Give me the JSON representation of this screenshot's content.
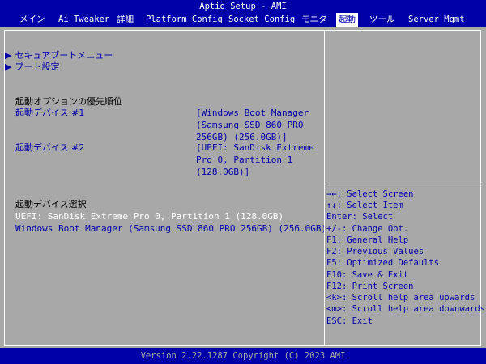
{
  "window": {
    "title": "Aptio Setup - AMI"
  },
  "tabs": [
    {
      "label": "メイン"
    },
    {
      "label": "Ai Tweaker"
    },
    {
      "label": "詳細"
    },
    {
      "label": "Platform Config"
    },
    {
      "label": "Socket Config"
    },
    {
      "label": "モニタ"
    },
    {
      "label": "起動",
      "active": true
    },
    {
      "label": "ツール"
    },
    {
      "label": "Server Mgmt"
    }
  ],
  "main": {
    "submenus": [
      {
        "arrow": "▶",
        "label": "セキュアブートメニュー"
      },
      {
        "arrow": "▶",
        "label": "ブート設定"
      }
    ],
    "boot_priority": {
      "heading": "起動オプションの優先順位",
      "items": [
        {
          "label": "起動デバイス #1",
          "value_lines": [
            "[Windows Boot Manager",
            "(Samsung SSD 860 PRO",
            "256GB) (256.0GB)]"
          ]
        },
        {
          "label": "起動デバイス #2",
          "value_lines": [
            "[UEFI: SanDisk Extreme",
            "Pro 0, Partition 1",
            "(128.0GB)]"
          ]
        }
      ]
    },
    "boot_select": {
      "heading": "起動デバイス選択",
      "items": [
        {
          "label": "UEFI: SanDisk Extreme Pro 0, Partition 1 (128.0GB)"
        },
        {
          "label": "Windows Boot Manager (Samsung SSD 860 PRO 256GB) (256.0GB)"
        }
      ]
    }
  },
  "help": {
    "keys": [
      "→←: Select Screen",
      "↑↓: Select Item",
      "Enter: Select",
      "+/-: Change Opt.",
      "F1: General Help",
      "F2: Previous Values",
      "F5: Optimized Defaults",
      "F10: Save & Exit",
      "F12: Print Screen",
      "<k>: Scroll help area upwards",
      "<m>: Scroll help area downwards",
      "ESC: Exit"
    ]
  },
  "footer": {
    "text": "Version 2.22.1287 Copyright (C) 2023 AMI"
  },
  "colors": {
    "bios_blue": "#0000a8",
    "bios_gray": "#a8a8a8",
    "text_white": "#ffffff"
  }
}
